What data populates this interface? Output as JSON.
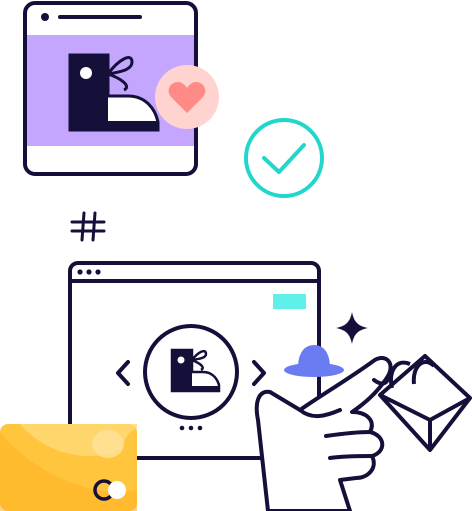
{
  "colors": {
    "ink": "#14103a",
    "purple": "#c4a6ff",
    "pink": "#ffd4d0",
    "heart": "#ff8a86",
    "teal": "#22d6cc",
    "cyan_badge": "#5ff0ea",
    "blue_hat": "#6b7bf2",
    "card_yellow": "#ffc53d",
    "card_light": "#ffd978",
    "white": "#ffffff"
  },
  "icons": {
    "product_card": "shoe-product-card-icon",
    "favorite": "heart-icon",
    "confirm": "checkmark-icon",
    "hash": "hash-icon",
    "browser_product": "shoe-icon",
    "prev": "chevron-left-icon",
    "next": "chevron-right-icon",
    "sparkle": "sparkle-icon",
    "hat": "hat-icon",
    "bag": "shopping-bag-icon",
    "hand": "hand-icon",
    "card": "payment-card-icon"
  }
}
